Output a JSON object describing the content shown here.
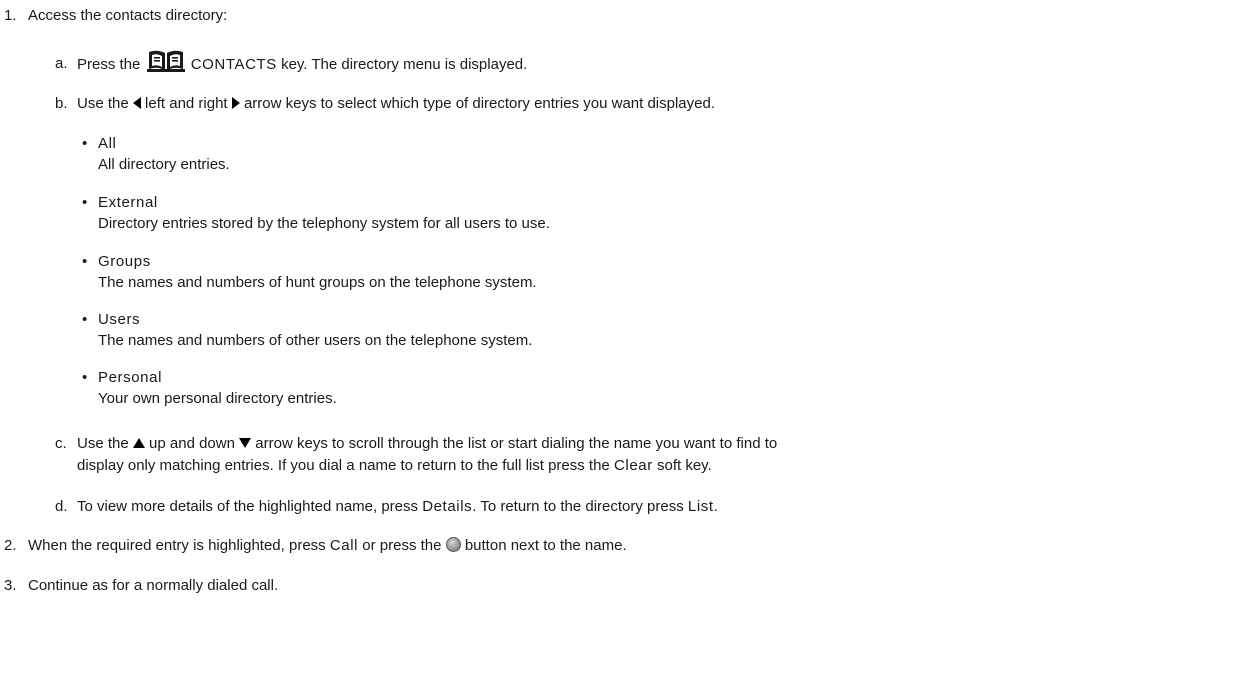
{
  "steps": {
    "s1": {
      "num": "1.",
      "text": "Access the contacts directory:"
    },
    "sa": {
      "num": "a.",
      "pre": "Press the",
      "key": "CONTACTS",
      "post": "key. The directory menu is displayed.",
      "icon": "book-icon"
    },
    "sb": {
      "num": "b.",
      "pre": "Use the",
      "mid": "left and right",
      "post": "arrow keys to select which type of directory entries you want displayed.",
      "icon_left": "left-arrow-icon",
      "icon_right": "right-arrow-icon"
    },
    "bullets": [
      {
        "title": "All",
        "desc": "All directory entries."
      },
      {
        "title": "External",
        "desc": "Directory entries stored by the telephony system for all users to use."
      },
      {
        "title": "Groups",
        "desc": "The names and numbers of hunt groups on the telephone system."
      },
      {
        "title": "Users",
        "desc": "The names and numbers of other users on the telephone system."
      },
      {
        "title": "Personal",
        "desc": "Your own personal directory entries."
      }
    ],
    "sc": {
      "num": "c.",
      "pre": "Use the",
      "mid": "up and down",
      "post": "arrow keys to scroll through the list or start dialing the name you want to find to",
      "line2_pre": "display only matching entries. If you dial a name to return to the full list press the",
      "line2_key": "Clear",
      "line2_post": "soft key.",
      "icon_up": "up-arrow-icon",
      "icon_down": "down-arrow-icon"
    },
    "sd": {
      "num": "d.",
      "pre": "To view more details of the highlighted name, press",
      "key1": "Details",
      "mid": ". To return to the directory press",
      "key2": "List",
      "post": "."
    },
    "s2": {
      "num": "2.",
      "pre": "When the required entry is highlighted, press",
      "key": "Call",
      "mid": "or press the",
      "post": "button next to the name.",
      "icon": "round-button-icon"
    },
    "s3": {
      "num": "3.",
      "text": "Continue as for a normally dialed call."
    }
  }
}
